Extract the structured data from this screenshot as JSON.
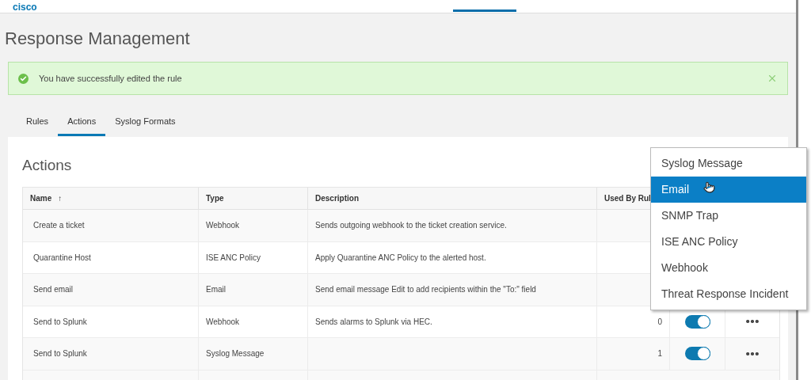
{
  "header": {
    "logo": "cisco"
  },
  "page_title": "Response Management",
  "alert": {
    "message": "You have successfully edited the rule"
  },
  "tabs": [
    {
      "label": "Rules",
      "selected": false
    },
    {
      "label": "Actions",
      "selected": true
    },
    {
      "label": "Syslog Formats",
      "selected": false
    }
  ],
  "card": {
    "title": "Actions"
  },
  "table": {
    "columns": [
      {
        "label": "Name",
        "sort_icon": "↑"
      },
      {
        "label": "Type"
      },
      {
        "label": "Description"
      },
      {
        "label": "Used By Rul"
      }
    ],
    "rows": [
      {
        "name": "Create a ticket",
        "type": "Webhook",
        "description": "Sends outgoing webhook to the ticket creation service."
      },
      {
        "name": "Quarantine Host",
        "type": "ISE ANC Policy",
        "description": "Apply Quarantine ANC Policy to the alerted host."
      },
      {
        "name": "Send email",
        "type": "Email",
        "description": "Send email message Edit to add recipients within the \"To:\" field"
      },
      {
        "name": "Send to Splunk",
        "type": "Webhook",
        "description": "Sends alarms to Splunk via HEC.",
        "used_by": "0",
        "on": true
      },
      {
        "name": "Send to Splunk",
        "type": "Syslog Message",
        "used_by": "1",
        "on": true
      }
    ]
  },
  "dropdown": {
    "items": [
      {
        "label": "Syslog Message",
        "selected": false
      },
      {
        "label": "Email",
        "selected": true
      },
      {
        "label": "SNMP Trap",
        "selected": false
      },
      {
        "label": "ISE ANC Policy",
        "selected": false
      },
      {
        "label": "Webhook",
        "selected": false
      },
      {
        "label": "Threat Response Incident",
        "selected": false
      }
    ]
  }
}
